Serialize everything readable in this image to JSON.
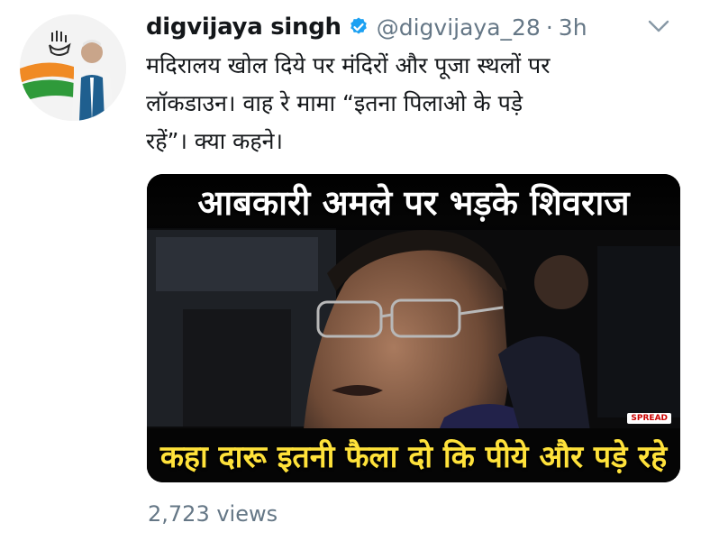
{
  "author": {
    "name": "digvijaya singh",
    "handle": "@digvijaya_28",
    "separator": "·",
    "time": "3h"
  },
  "tweet": {
    "lines": [
      "मदिरालय खोल दिये पर मंदिरों और पूजा स्थलों पर",
      "लॉकडाउन। वाह रे मामा “इतना पिलाओ के पड़े",
      "रहें”। क्या कहने।"
    ]
  },
  "media": {
    "caption_top": "आबकारी अमले पर भड़के शिवराज",
    "caption_bottom": "कहा दारू इतनी फैला दो कि पीये और पड़े रहे",
    "watermark": "SPREAD"
  },
  "stats": {
    "views": "2,723 views"
  },
  "colors": {
    "verified": "#1da1f2",
    "muted": "#657786",
    "caption_bottom": "#ffe23a"
  },
  "icons": [
    "verified-badge-icon",
    "chevron-down-icon"
  ]
}
